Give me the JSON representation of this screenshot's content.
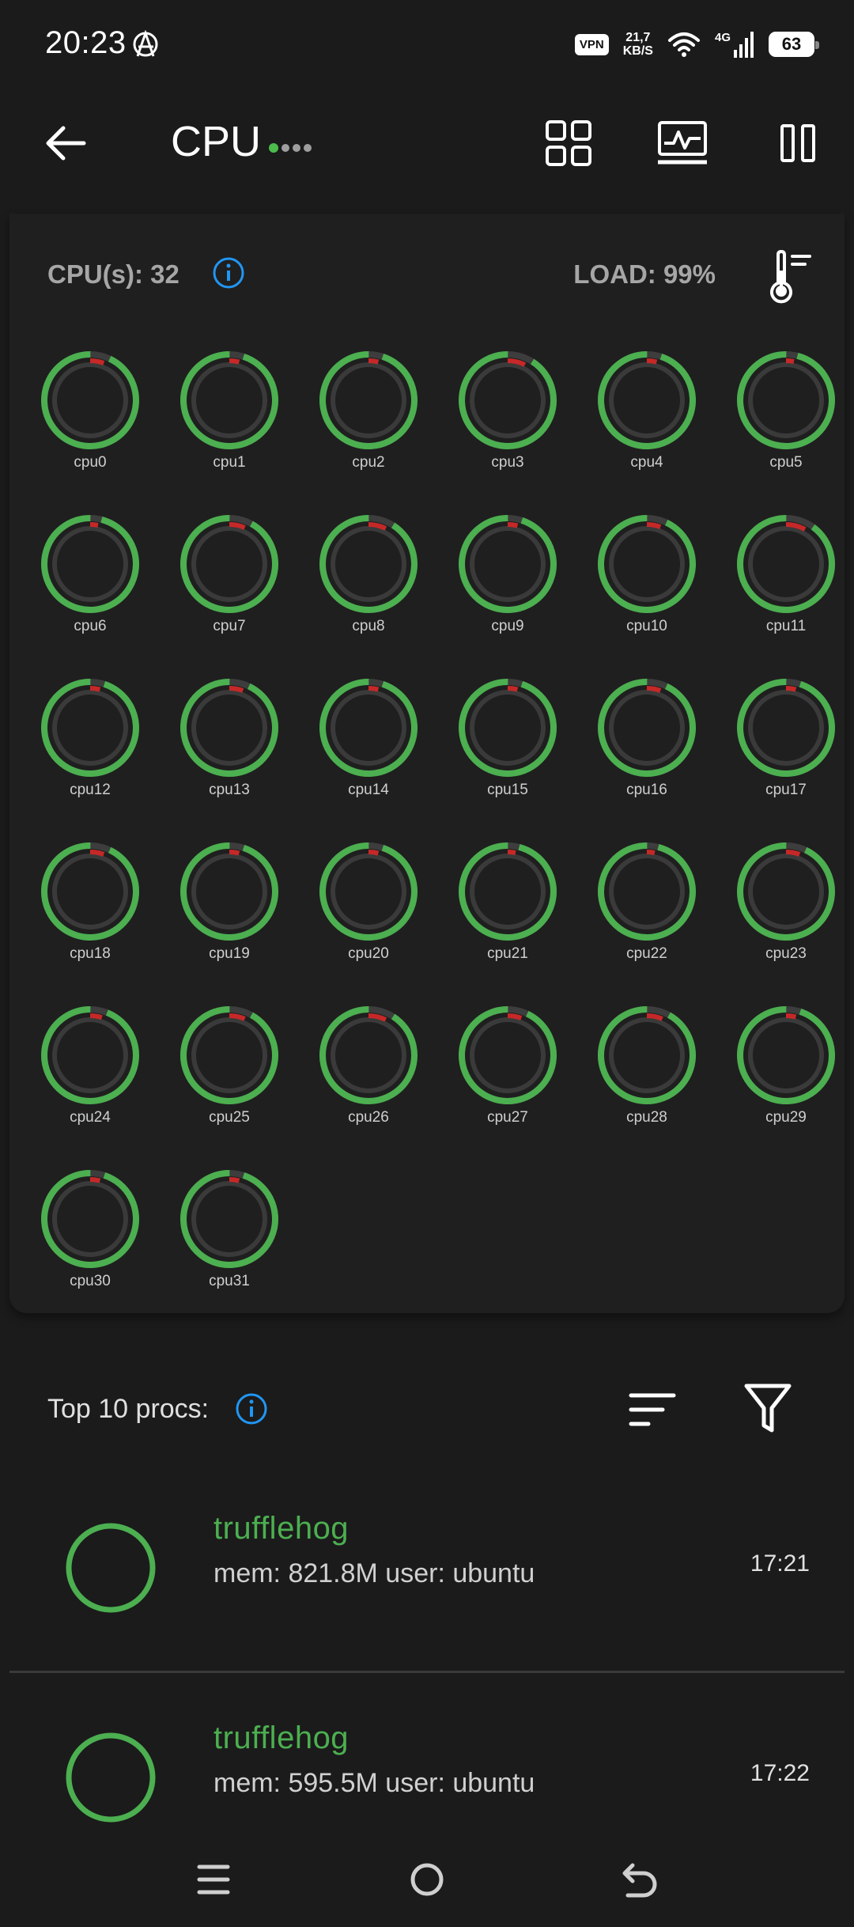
{
  "status_bar": {
    "time": "20:23",
    "vpn": "VPN",
    "speed_value": "21,7",
    "speed_unit": "KB/S",
    "network": "4G",
    "battery": "63"
  },
  "app_bar": {
    "title": "CPU",
    "icons": [
      "back-arrow-icon",
      "grid-view-icon",
      "monitor-chart-icon",
      "columns-icon"
    ]
  },
  "cpu_panel": {
    "count_label": "CPU(s): 32",
    "load_label": "LOAD: 99%",
    "colors": {
      "ring_track": "#3d3d3d",
      "ring_progress": "#4caf50",
      "ring_marker": "#c62828",
      "accent_info": "#2196f3"
    },
    "cores": [
      {
        "label": "cpu0",
        "fill": 0.93
      },
      {
        "label": "cpu1",
        "fill": 0.95
      },
      {
        "label": "cpu2",
        "fill": 0.95
      },
      {
        "label": "cpu3",
        "fill": 0.91
      },
      {
        "label": "cpu4",
        "fill": 0.95
      },
      {
        "label": "cpu5",
        "fill": 0.96
      },
      {
        "label": "cpu6",
        "fill": 0.96
      },
      {
        "label": "cpu7",
        "fill": 0.92
      },
      {
        "label": "cpu8",
        "fill": 0.91
      },
      {
        "label": "cpu9",
        "fill": 0.95
      },
      {
        "label": "cpu10",
        "fill": 0.93
      },
      {
        "label": "cpu11",
        "fill": 0.9
      },
      {
        "label": "cpu12",
        "fill": 0.95
      },
      {
        "label": "cpu13",
        "fill": 0.93
      },
      {
        "label": "cpu14",
        "fill": 0.95
      },
      {
        "label": "cpu15",
        "fill": 0.95
      },
      {
        "label": "cpu16",
        "fill": 0.93
      },
      {
        "label": "cpu17",
        "fill": 0.95
      },
      {
        "label": "cpu18",
        "fill": 0.93
      },
      {
        "label": "cpu19",
        "fill": 0.95
      },
      {
        "label": "cpu20",
        "fill": 0.95
      },
      {
        "label": "cpu21",
        "fill": 0.96
      },
      {
        "label": "cpu22",
        "fill": 0.96
      },
      {
        "label": "cpu23",
        "fill": 0.93
      },
      {
        "label": "cpu24",
        "fill": 0.94
      },
      {
        "label": "cpu25",
        "fill": 0.92
      },
      {
        "label": "cpu26",
        "fill": 0.91
      },
      {
        "label": "cpu27",
        "fill": 0.93
      },
      {
        "label": "cpu28",
        "fill": 0.92
      },
      {
        "label": "cpu29",
        "fill": 0.95
      },
      {
        "label": "cpu30",
        "fill": 0.95
      },
      {
        "label": "cpu31",
        "fill": 0.95
      }
    ]
  },
  "procs": {
    "title": "Top 10 procs:",
    "items": [
      {
        "name": "trufflehog",
        "detail": "mem: 821.8M user: ubuntu",
        "time": "17:21"
      },
      {
        "name": "trufflehog",
        "detail": "mem: 595.5M user: ubuntu",
        "time": "17:22"
      }
    ]
  },
  "nav_bar": {
    "icons": [
      "menu-icon",
      "home-icon",
      "back-icon"
    ]
  }
}
